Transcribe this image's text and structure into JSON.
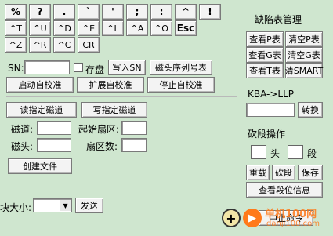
{
  "keys_row1": [
    "%",
    "?",
    ".",
    "`",
    "'",
    ";",
    ":",
    "^",
    "!"
  ],
  "keys_row2": [
    "^T",
    "^U",
    "^D",
    "^E",
    "^L",
    "^A",
    "^O",
    "Esc"
  ],
  "keys_row3": [
    "^Z",
    "^R",
    "^C",
    "CR"
  ],
  "defect_table": {
    "title": "缺陷表管理",
    "view_p": "查看P表",
    "clear_p": "清空P表",
    "view_g": "查看G表",
    "clear_g": "清空G表",
    "view_t": "查看T表",
    "clear_smart": "清SMART"
  },
  "sn": {
    "label": "SN:",
    "value": "",
    "save_label": "存盘",
    "write_sn": "写入SN",
    "head_seq": "磁头序列号表"
  },
  "calibration": {
    "start": "启动自校准",
    "extended": "扩展自校准",
    "stop": "停止自校准"
  },
  "track_io": {
    "read": "读指定磁道",
    "write": "写指定磁道",
    "track_label": "磁道:",
    "start_sector_label": "起始扇区:",
    "head_label": "磁头:",
    "sector_count_label": "扇区数:",
    "create_file": "创建文件"
  },
  "kba": {
    "title": "KBA->LLP",
    "value": "",
    "convert": "转换"
  },
  "cut_section": {
    "title": "砍段操作",
    "head_label": "头",
    "seg_label": "段",
    "reload": "重载",
    "cut": "砍段",
    "save": "保存",
    "view_info": "查看段位信息"
  },
  "block_size": {
    "label": "块大小:",
    "value": "",
    "send": "发送"
  },
  "stop_cmd": "中止命令",
  "watermark": {
    "brand": "单机100网",
    "url": "danji100.com",
    "plus": "+"
  },
  "colors": {
    "background": "#cfe6cf",
    "button": "#f3f3f3",
    "watermark_orange": "#ff7a1a"
  }
}
